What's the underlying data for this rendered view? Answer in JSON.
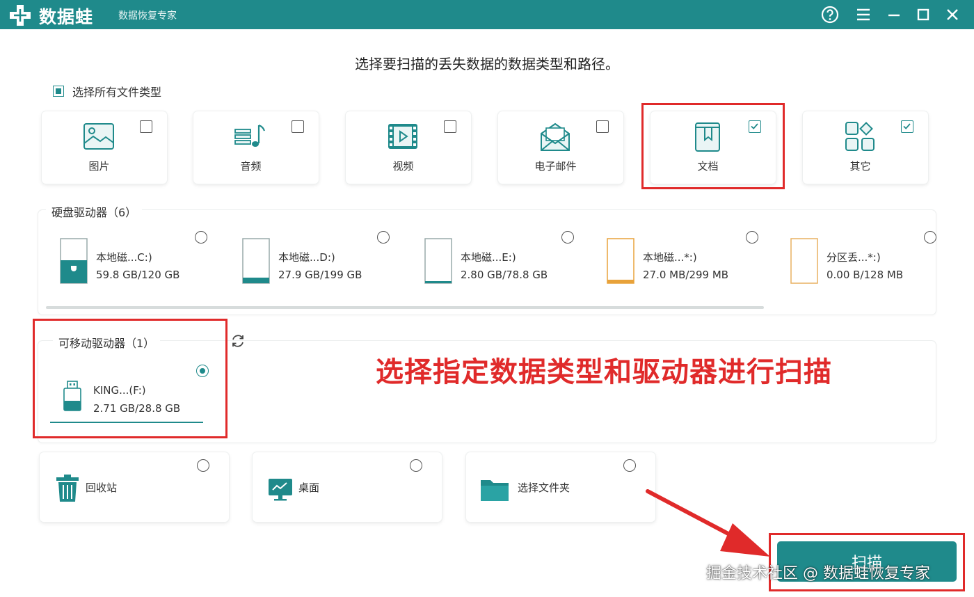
{
  "app": {
    "name": "数据蛙",
    "subtitle": "数据恢复专家",
    "accent_color": "#1f8a8b"
  },
  "titlebar_buttons": [
    "help-icon",
    "menu-icon",
    "minimize-icon",
    "maximize-icon",
    "close-icon"
  ],
  "heading": "选择要扫描的丢失数据的数据类型和路径。",
  "select_all": {
    "label": "选择所有文件类型",
    "state": "partial"
  },
  "file_types": [
    {
      "label": "图片",
      "icon": "image-icon",
      "checked": false
    },
    {
      "label": "音频",
      "icon": "audio-icon",
      "checked": false
    },
    {
      "label": "视频",
      "icon": "video-icon",
      "checked": false
    },
    {
      "label": "电子邮件",
      "icon": "email-icon",
      "checked": false
    },
    {
      "label": "文档",
      "icon": "document-icon",
      "checked": true
    },
    {
      "label": "其它",
      "icon": "other-icon",
      "checked": true
    }
  ],
  "hard_drives": {
    "title": "硬盘驱动器（6）",
    "items": [
      {
        "name": "本地磁...C:)",
        "size": "59.8 GB/120 GB",
        "icon": "system-drive-icon",
        "selected": false
      },
      {
        "name": "本地磁...D:)",
        "size": "27.9 GB/199 GB",
        "icon": "drive-icon",
        "selected": false
      },
      {
        "name": "本地磁...E:)",
        "size": "2.80 GB/78.8 GB",
        "icon": "drive-icon",
        "selected": false
      },
      {
        "name": "本地磁...*:)",
        "size": "27.0 MB/299 MB",
        "icon": "drive-icon-orange",
        "selected": false
      },
      {
        "name": "分区丢...*:)",
        "size": "0.00  B/128 MB",
        "icon": "lost-partition-icon",
        "selected": false
      }
    ]
  },
  "removable_drives": {
    "title": "可移动驱动器（1）",
    "items": [
      {
        "name": "KING...(F:)",
        "size": "2.71 GB/28.8 GB",
        "icon": "usb-drive-icon",
        "selected": true
      }
    ]
  },
  "locations": [
    {
      "label": "回收站",
      "icon": "recycle-bin-icon",
      "selected": false
    },
    {
      "label": "桌面",
      "icon": "desktop-icon",
      "selected": false
    },
    {
      "label": "选择文件夹",
      "icon": "folder-icon",
      "selected": false
    }
  ],
  "annotation": "选择指定数据类型和驱动器进行扫描",
  "scan_button": "扫描",
  "watermark": "掘金技术社区 @ 数据蛙恢复专家",
  "highlight_color": "#e02a2a"
}
